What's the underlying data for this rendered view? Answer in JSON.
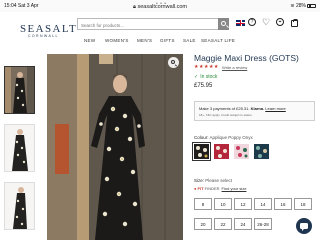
{
  "status_bar": {
    "time": "15:04",
    "date": "Sat 3 Apr",
    "url": "seasaltcornwall.com",
    "battery": "28%"
  },
  "header": {
    "logo": "SEASALT",
    "logo_sub": "CORNWALL",
    "search_placeholder": "Search for products..."
  },
  "nav": [
    "NEW",
    "WOMEN'S",
    "MEN'S",
    "GIFTS",
    "SALE",
    "SEASALT LIFE"
  ],
  "product": {
    "title": "Maggie Maxi Dress (GOTS)",
    "stars": "★★★★★",
    "reviews": "Write a review",
    "stock": "In stock",
    "price": "£75.95",
    "klarna_line1_prefix": "Make 3 payments of £25.31.",
    "klarna_brand": "Klarna.",
    "klarna_link": "Learn more",
    "klarna_line2": "18+, T&C apply. Credit subject to status.",
    "colour_label": "Colour:",
    "colour_value": "Applique Poppy Onyx",
    "size_label": "Size:",
    "size_value": "Please select",
    "fit_logo": "FIT",
    "fit_finder": "FINDER",
    "fit_link": "Find your size",
    "sizes": [
      "8",
      "10",
      "12",
      "14",
      "16",
      "18",
      "20",
      "22",
      "24",
      "26-28"
    ]
  },
  "colors": {
    "brand": "#1f3550",
    "stock": "#2a8a3a",
    "stars": "#c9372c"
  }
}
